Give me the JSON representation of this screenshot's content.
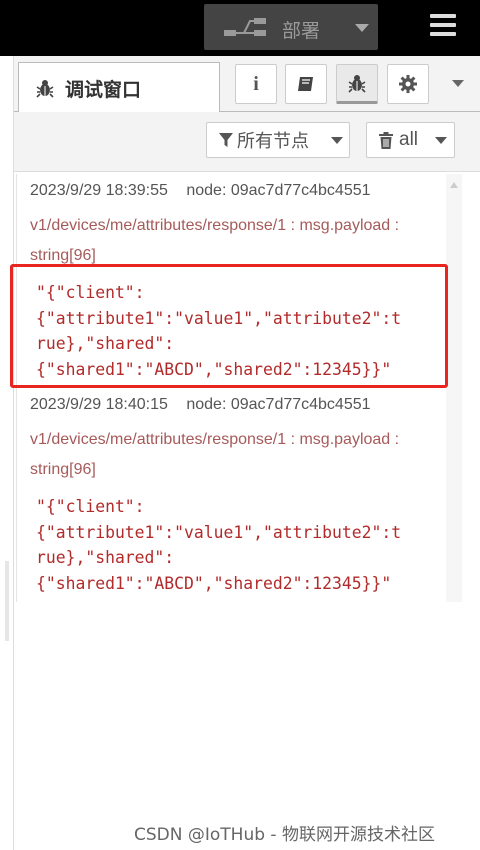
{
  "header": {
    "deploy_label": "部署",
    "deploy_icon": "flow-deploy-icon",
    "menu_icon": "hamburger-icon"
  },
  "sidebar": {
    "tabs": [
      {
        "label": "调试窗口",
        "icon": "bug-icon",
        "active": true
      },
      {
        "label": "i",
        "icon": "info-icon"
      },
      {
        "label": "",
        "icon": "book-icon"
      },
      {
        "label": "",
        "icon": "bug-icon",
        "active": true
      },
      {
        "label": "",
        "icon": "gear-icon"
      }
    ],
    "more_icon": "caret-down-icon"
  },
  "toolbar": {
    "filter_label": "所有节点",
    "filter_icon": "funnel-icon",
    "clear_label": "all",
    "clear_icon": "trash-icon"
  },
  "messages": [
    {
      "timestamp": "2023/9/29 18:39:55",
      "node": "node: 09ac7d77c4bc4551",
      "topic": "v1/devices/me/attributes/response/1 : msg.payload : string[96]",
      "payload": "\"{\"client\":\n{\"attribute1\":\"value1\",\"attribute2\":t\nrue},\"shared\":\n{\"shared1\":\"ABCD\",\"shared2\":12345}}\"",
      "highlighted": true
    },
    {
      "timestamp": "2023/9/29 18:40:15",
      "node": "node: 09ac7d77c4bc4551",
      "topic": "v1/devices/me/attributes/response/1 : msg.payload : string[96]",
      "payload": "\"{\"client\":\n{\"attribute1\":\"value1\",\"attribute2\":t\nrue},\"shared\":\n{\"shared1\":\"ABCD\",\"shared2\":12345}}\"",
      "highlighted": false
    }
  ],
  "watermark": "CSDN @IoTHub - 物联网开源技术社区",
  "colors": {
    "highlight": "#e8251f",
    "payload": "#b22b2b",
    "topic": "#a65a5a"
  }
}
